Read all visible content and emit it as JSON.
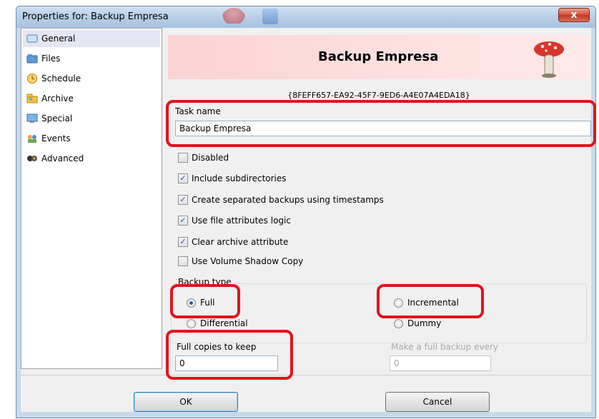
{
  "window": {
    "title": "Properties for: Backup Empresa",
    "close_glyph": "x"
  },
  "sidebar": {
    "items": [
      {
        "label": "General",
        "icon": "general-icon"
      },
      {
        "label": "Files",
        "icon": "files-icon"
      },
      {
        "label": "Schedule",
        "icon": "schedule-icon"
      },
      {
        "label": "Archive",
        "icon": "archive-icon"
      },
      {
        "label": "Special",
        "icon": "special-icon"
      },
      {
        "label": "Events",
        "icon": "events-icon"
      },
      {
        "label": "Advanced",
        "icon": "advanced-icon"
      }
    ],
    "selected": "General"
  },
  "header": {
    "title": "Backup Empresa",
    "guid": "{8FEFF657-EA92-45F7-9ED6-A4E07A4EDA18}"
  },
  "task": {
    "label": "Task name",
    "value": "Backup Empresa"
  },
  "options": [
    {
      "label": "Disabled",
      "checked": false
    },
    {
      "label": "Include subdirectories",
      "checked": true
    },
    {
      "label": "Create separated backups using timestamps",
      "checked": true
    },
    {
      "label": "Use file attributes logic",
      "checked": true
    },
    {
      "label": "Clear archive attribute",
      "checked": true
    },
    {
      "label": "Use Volume Shadow Copy",
      "checked": false
    }
  ],
  "backup_type": {
    "label": "Backup type",
    "options": [
      "Full",
      "Incremental",
      "Differential",
      "Dummy"
    ],
    "selected": "Full"
  },
  "copies": {
    "label": "Full copies to keep",
    "value": "0"
  },
  "full_every": {
    "label": "Make a full backup every",
    "value": "0"
  },
  "buttons": {
    "ok": "OK",
    "cancel": "Cancel"
  },
  "colors": {
    "annotation": "#e0141e",
    "banner_start": "#fbd3d3",
    "check_accent": "#1a58b0"
  }
}
